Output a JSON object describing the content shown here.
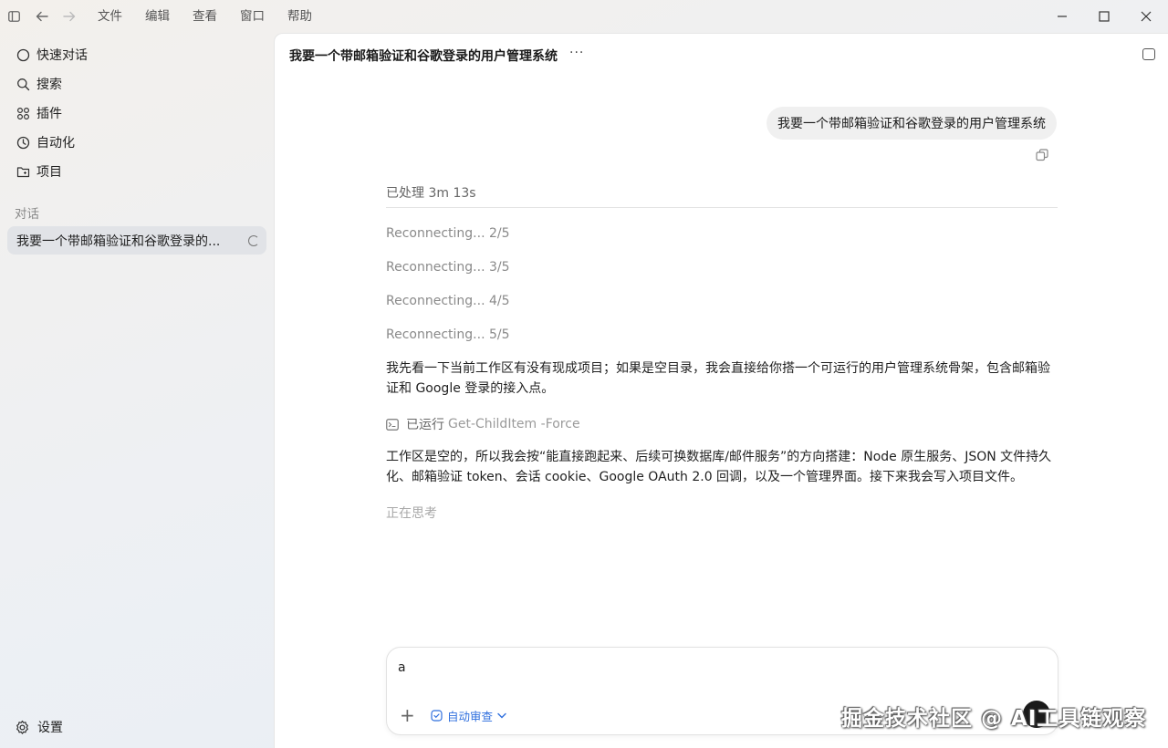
{
  "titlebar": {
    "menu": [
      "文件",
      "编辑",
      "查看",
      "窗口",
      "帮助"
    ]
  },
  "sidebar": {
    "nav": [
      {
        "label": "快速对话",
        "icon": "chat-bubble-icon"
      },
      {
        "label": "搜索",
        "icon": "search-icon"
      },
      {
        "label": "插件",
        "icon": "plugins-grid-icon"
      },
      {
        "label": "自动化",
        "icon": "clock-icon"
      },
      {
        "label": "项目",
        "icon": "folder-plus-icon"
      }
    ],
    "section_label": "对话",
    "conversation": "我要一个带邮箱验证和谷歌登录的...",
    "settings_label": "设置"
  },
  "main": {
    "title": "我要一个带邮箱验证和谷歌登录的用户管理系统",
    "more": "···",
    "user_message": "我要一个带邮箱验证和谷歌登录的用户管理系统",
    "processed": "已处理 3m 13s",
    "reconnecting": [
      "Reconnecting... 2/5",
      "Reconnecting... 3/5",
      "Reconnecting... 4/5",
      "Reconnecting... 5/5"
    ],
    "paragraph1": "我先看一下当前工作区有没有现成项目；如果是空目录，我会直接给你搭一个可运行的用户管理系统骨架，包含邮箱验证和 Google 登录的接入点。",
    "ran_label": "已运行",
    "ran_command": "Get-ChildItem -Force",
    "paragraph2": "工作区是空的，所以我会按“能直接跑起来、后续可换数据库/邮件服务”的方向搭建：Node 原生服务、JSON 文件持久化、邮箱验证 token、会话 cookie、Google OAuth 2.0 回调，以及一个管理界面。接下来我会写入项目文件。",
    "thinking": "正在思考"
  },
  "composer": {
    "value": "a",
    "plus": "+",
    "mode_label": "自动审查"
  },
  "watermark": "掘金技术社区 @ AI工具链观察"
}
